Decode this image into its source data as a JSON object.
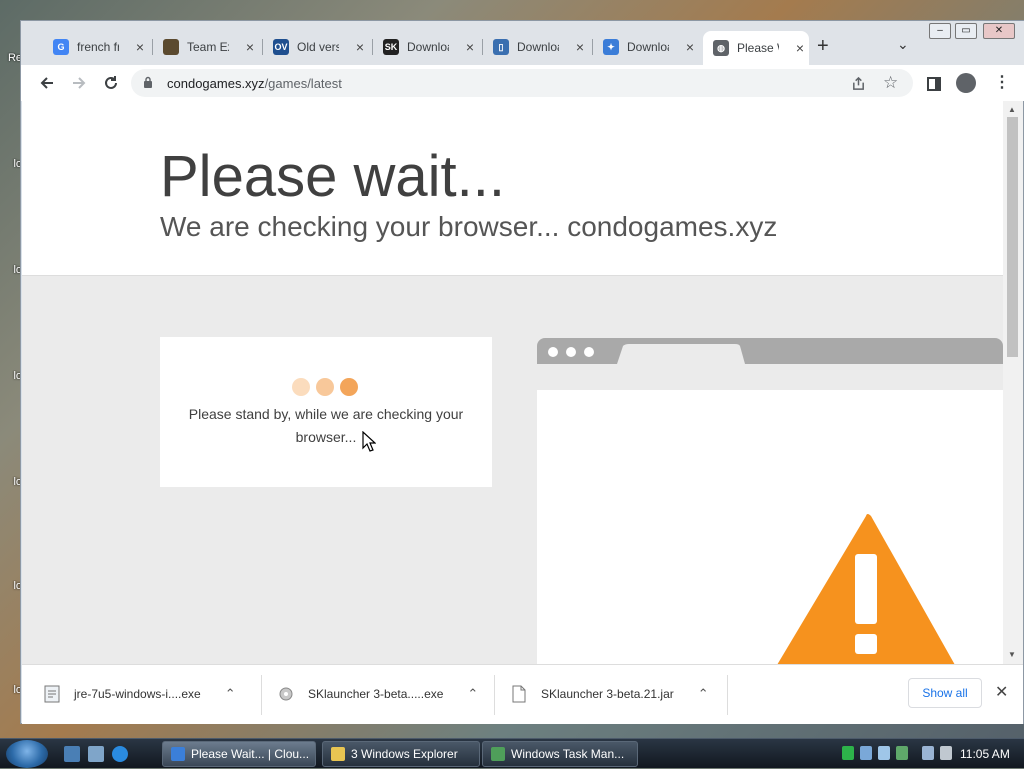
{
  "browser": {
    "tabs": [
      {
        "label": "french fr",
        "favicon": "google-icon",
        "color": "#4285f4",
        "glyph": "G"
      },
      {
        "label": "Team Ext",
        "favicon": "minecraft-icon",
        "color": "#5b4a2f",
        "glyph": ""
      },
      {
        "label": "Old versi",
        "favicon": "ov-icon",
        "color": "#1f4f8f",
        "glyph": "OV"
      },
      {
        "label": "Downloa",
        "favicon": "sk-icon",
        "color": "#222222",
        "glyph": "SK"
      },
      {
        "label": "Downloa",
        "favicon": "document-icon",
        "color": "#3a6fb0",
        "glyph": "▯"
      },
      {
        "label": "Downloa",
        "favicon": "bird-icon",
        "color": "#3b7dd8",
        "glyph": "✦"
      },
      {
        "label": "Please W",
        "favicon": "globe-icon",
        "color": "#5f6368",
        "glyph": "◍"
      }
    ],
    "new_tab": "+",
    "tab_search": "⌄",
    "window_controls": {
      "minimize": "–",
      "restore": "▭",
      "close": "✕"
    },
    "url_host": "condogames.xyz",
    "url_path": "/games/latest"
  },
  "page": {
    "title": "Please wait...",
    "subtitle": "We are checking your browser... condogames.xyz",
    "standby": "Please stand by, while we are checking your browser...",
    "accent_color": "#f6921e"
  },
  "downloads": {
    "items": [
      {
        "name": "jre-7u5-windows-i....exe",
        "icon": "installer-icon"
      },
      {
        "name": "SKlauncher 3-beta.....exe",
        "icon": "gear-file-icon"
      },
      {
        "name": "SKlauncher 3-beta.21.jar",
        "icon": "file-icon"
      }
    ],
    "show_all": "Show all",
    "close": "✕"
  },
  "taskbar": {
    "buttons": [
      {
        "label": "Please Wait... | Clou...",
        "active": true
      },
      {
        "label": "3 Windows Explorer",
        "active": false
      },
      {
        "label": "Windows Task Man...",
        "active": false
      }
    ],
    "clock": "11:05 AM"
  }
}
